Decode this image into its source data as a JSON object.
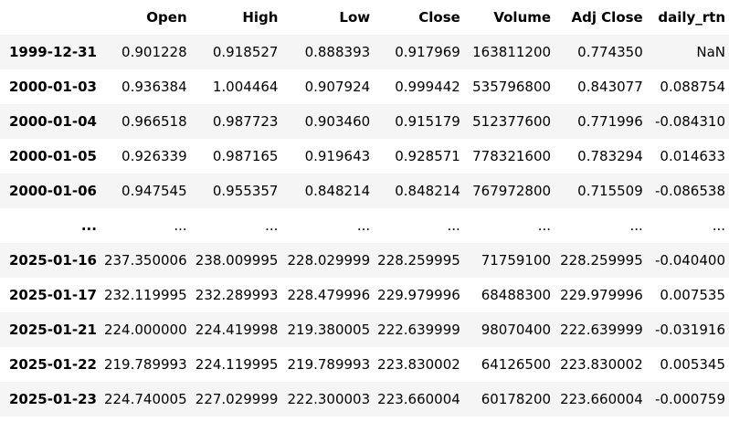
{
  "table": {
    "index_header": "",
    "columns": [
      "Open",
      "High",
      "Low",
      "Close",
      "Volume",
      "Adj Close",
      "daily_rtn"
    ],
    "rows": [
      {
        "index": "1999-12-31",
        "cells": [
          "0.901228",
          "0.918527",
          "0.888393",
          "0.917969",
          "163811200",
          "0.774350",
          "NaN"
        ]
      },
      {
        "index": "2000-01-03",
        "cells": [
          "0.936384",
          "1.004464",
          "0.907924",
          "0.999442",
          "535796800",
          "0.843077",
          "0.088754"
        ]
      },
      {
        "index": "2000-01-04",
        "cells": [
          "0.966518",
          "0.987723",
          "0.903460",
          "0.915179",
          "512377600",
          "0.771996",
          "-0.084310"
        ]
      },
      {
        "index": "2000-01-05",
        "cells": [
          "0.926339",
          "0.987165",
          "0.919643",
          "0.928571",
          "778321600",
          "0.783294",
          "0.014633"
        ]
      },
      {
        "index": "2000-01-06",
        "cells": [
          "0.947545",
          "0.955357",
          "0.848214",
          "0.848214",
          "767972800",
          "0.715509",
          "-0.086538"
        ]
      },
      {
        "index": "...",
        "cells": [
          "...",
          "...",
          "...",
          "...",
          "...",
          "...",
          "..."
        ]
      },
      {
        "index": "2025-01-16",
        "cells": [
          "237.350006",
          "238.009995",
          "228.029999",
          "228.259995",
          "71759100",
          "228.259995",
          "-0.040400"
        ]
      },
      {
        "index": "2025-01-17",
        "cells": [
          "232.119995",
          "232.289993",
          "228.479996",
          "229.979996",
          "68488300",
          "229.979996",
          "0.007535"
        ]
      },
      {
        "index": "2025-01-21",
        "cells": [
          "224.000000",
          "224.419998",
          "219.380005",
          "222.639999",
          "98070400",
          "222.639999",
          "-0.031916"
        ]
      },
      {
        "index": "2025-01-22",
        "cells": [
          "219.789993",
          "224.119995",
          "219.789993",
          "223.830002",
          "64126500",
          "223.830002",
          "0.005345"
        ]
      },
      {
        "index": "2025-01-23",
        "cells": [
          "224.740005",
          "227.029999",
          "222.300003",
          "223.660004",
          "60178200",
          "223.660004",
          "-0.000759"
        ]
      }
    ]
  }
}
